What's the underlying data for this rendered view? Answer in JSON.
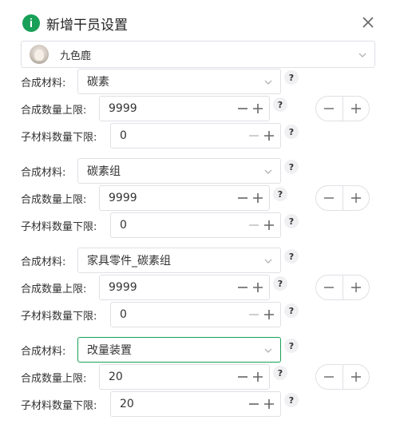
{
  "dialog": {
    "title": "新增干员设置",
    "operator": {
      "name": "九色鹿"
    }
  },
  "labels": {
    "material": "合成材料:",
    "upper_limit": "合成数量上限:",
    "sub_lower_limit": "子材料数量下限:",
    "help": "?"
  },
  "groups": [
    {
      "material": "碳素",
      "upper_limit": "9999",
      "sub_lower_limit": "0"
    },
    {
      "material": "碳素组",
      "upper_limit": "9999",
      "sub_lower_limit": "0"
    },
    {
      "material": "家具零件_碳素组",
      "upper_limit": "9999",
      "sub_lower_limit": "0"
    },
    {
      "material": "改量装置",
      "upper_limit": "20",
      "sub_lower_limit": "20"
    }
  ],
  "colors": {
    "accent": "#18a058",
    "border": "#e0e0e6",
    "icon": "#666666",
    "disabled": "#c2c2c2"
  }
}
